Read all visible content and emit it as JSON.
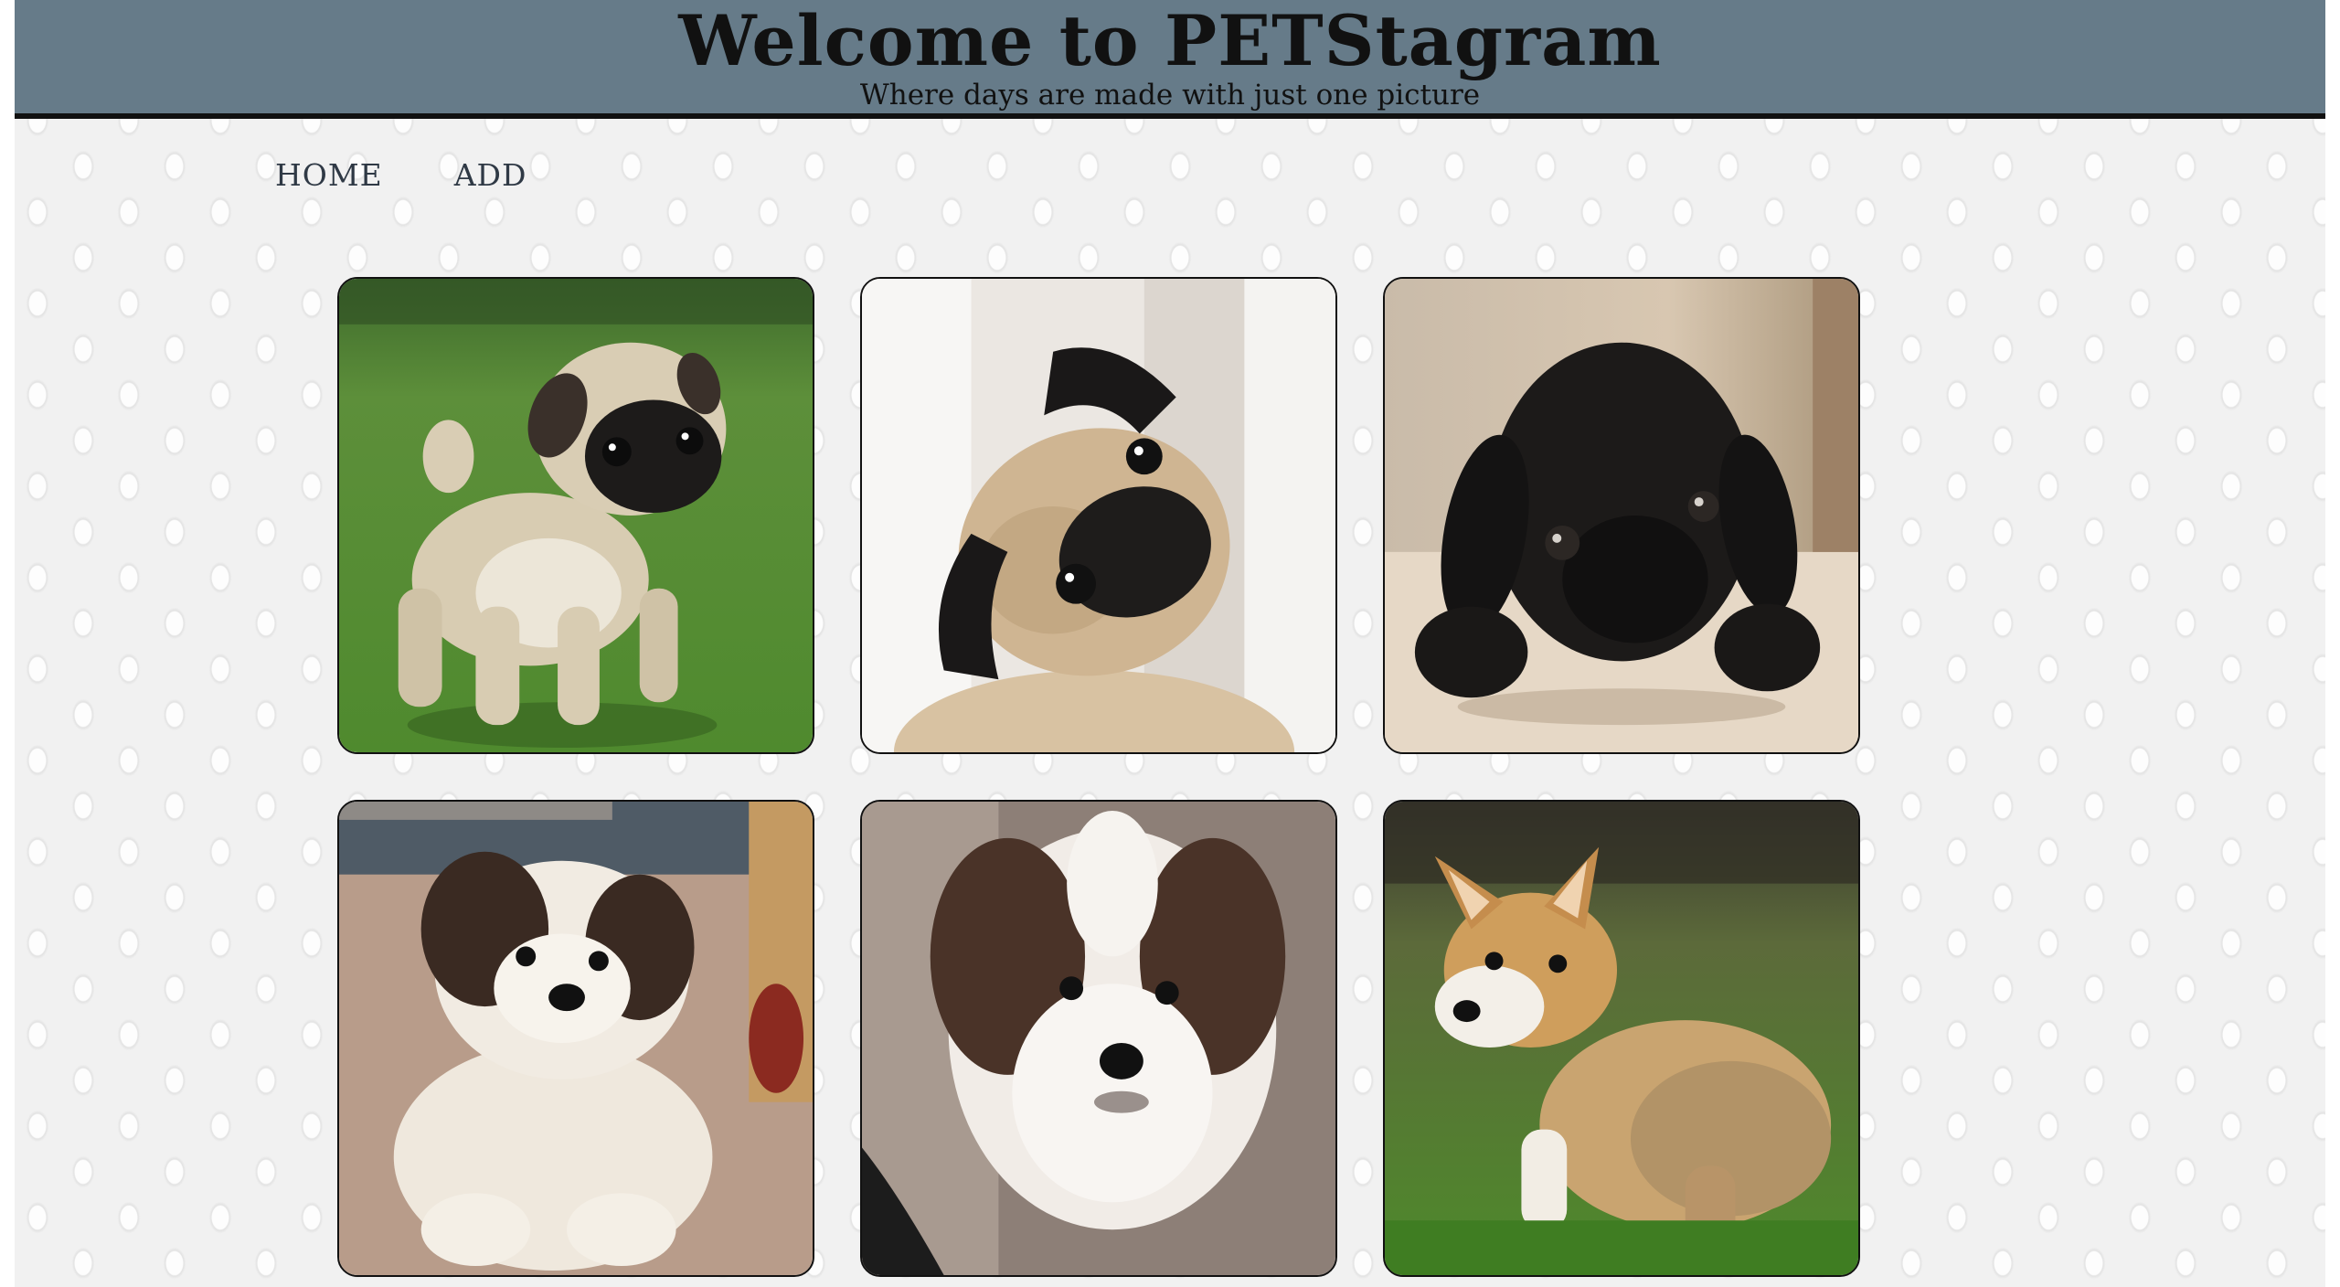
{
  "header": {
    "title": "Welcome to PETStagram",
    "subtitle": "Where days are made with just one picture",
    "background_color": "#667b89"
  },
  "nav": {
    "items": [
      {
        "label": "HOME"
      },
      {
        "label": "ADD"
      }
    ]
  },
  "gallery": {
    "photos": [
      {
        "subject": "fawn pug puppy standing on grass"
      },
      {
        "subject": "fawn pug puppy tilting head"
      },
      {
        "subject": "black pug puppy lying on floor"
      },
      {
        "subject": "white and brown shih tzu puppy sitting"
      },
      {
        "subject": "black white and brown shih tzu puppy close-up"
      },
      {
        "subject": "corgi puppy on grass looking back"
      }
    ]
  }
}
